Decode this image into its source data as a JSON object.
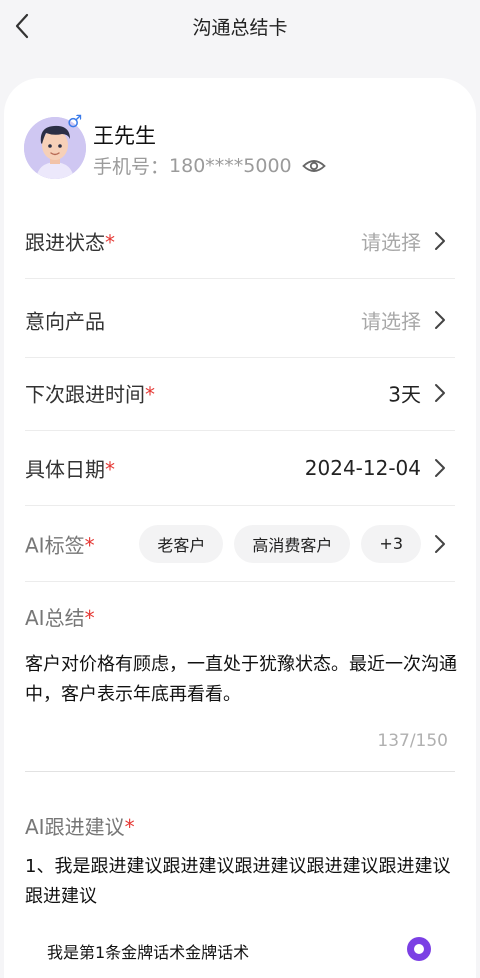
{
  "nav": {
    "title": "沟通总结卡"
  },
  "customer": {
    "name": "王先生",
    "gender_symbol": "♂",
    "phone_label": "手机号：",
    "phone_value": "180****5000"
  },
  "fields": {
    "follow_status": {
      "label": "跟进状态",
      "value": "请选择"
    },
    "intent_product": {
      "label": "意向产品",
      "value": "请选择"
    },
    "next_follow_time": {
      "label": "下次跟进时间",
      "value": "3天"
    },
    "specific_date": {
      "label": "具体日期",
      "value": "2024-12-04"
    },
    "ai_tags": {
      "label": "AI标签",
      "tags": [
        "老客户",
        "高消费客户",
        "+3"
      ]
    }
  },
  "required_mark": "*",
  "ai_summary": {
    "title": "AI总结",
    "text": "客户对价格有顾虑，一直处于犹豫状态。最近一次沟通中，客户表示年底再看看。",
    "counter": "137/150"
  },
  "ai_suggestion": {
    "title": "AI跟进建议",
    "text": "1、我是跟进建议跟进建议跟进建议跟进建议跟进建议跟进建议",
    "script_option": "我是第1条金牌话术金牌话术",
    "script_selected": true
  },
  "colors": {
    "accent": "#7b3fe4",
    "required": "#e53935",
    "gender": "#3a7bea"
  },
  "icons": {
    "back": "back-arrow-icon",
    "eye": "eye-icon",
    "chevron": "chevron-right-icon"
  }
}
